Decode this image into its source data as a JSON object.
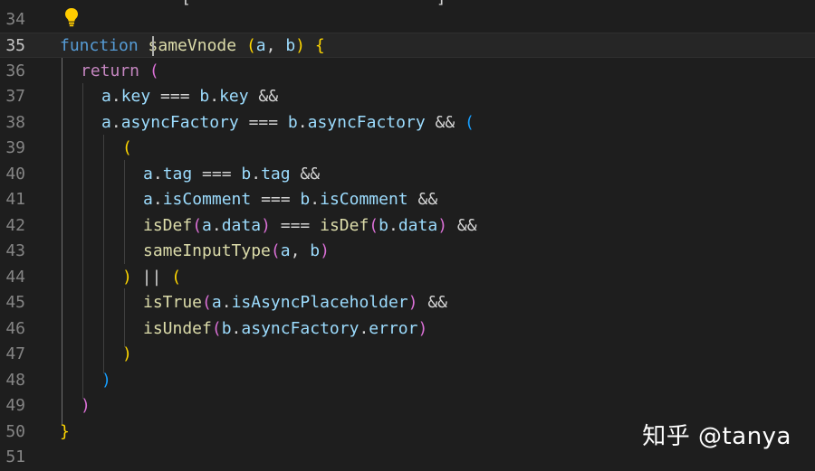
{
  "editor": {
    "top_fragment": "[                         ]",
    "lines": [
      {
        "n": "34",
        "text": ""
      },
      {
        "n": "35",
        "text": "function sameVnode (a, b) {"
      },
      {
        "n": "36",
        "text": "return ("
      },
      {
        "n": "37",
        "text": "a.key === b.key &&"
      },
      {
        "n": "38",
        "text": "a.asyncFactory === b.asyncFactory && ("
      },
      {
        "n": "39",
        "text": "("
      },
      {
        "n": "40",
        "text": "a.tag === b.tag &&"
      },
      {
        "n": "41",
        "text": "a.isComment === b.isComment &&"
      },
      {
        "n": "42",
        "text": "isDef(a.data) === isDef(b.data) &&"
      },
      {
        "n": "43",
        "text": "sameInputType(a, b)"
      },
      {
        "n": "44",
        "text": ") || ("
      },
      {
        "n": "45",
        "text": "isTrue(a.isAsyncPlaceholder) &&"
      },
      {
        "n": "46",
        "text": "isUndef(b.asyncFactory.error)"
      },
      {
        "n": "47",
        "text": ")"
      },
      {
        "n": "48",
        "text": ")"
      },
      {
        "n": "49",
        "text": ")"
      },
      {
        "n": "50",
        "text": "}"
      },
      {
        "n": "51",
        "text": ""
      }
    ]
  },
  "lightbulb_icon": "lightbulb-icon",
  "watermark": "知乎 @tanya",
  "colors": {
    "background": "#1e1e1e",
    "keyword_blue": "#569cd6",
    "keyword_purple": "#c586c0",
    "function": "#dcdcaa",
    "variable": "#9cdcfe",
    "bracket_gold": "#ffd700",
    "bracket_orchid": "#da70d6",
    "bracket_blue": "#179fff"
  }
}
